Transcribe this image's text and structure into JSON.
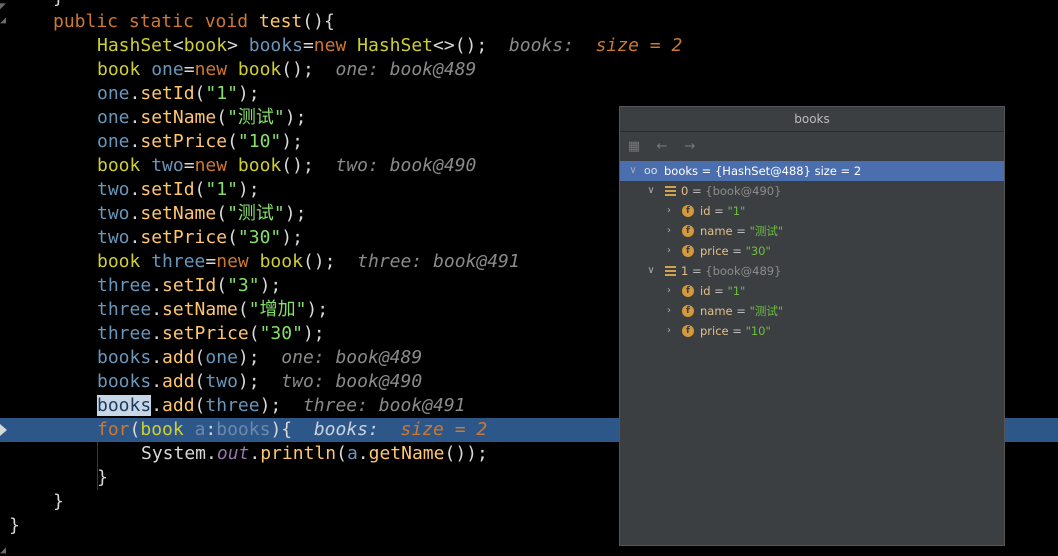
{
  "code": {
    "line0": "}",
    "line1": {
      "kw": "public static void ",
      "name": "test",
      "rest": "(){"
    },
    "line2": {
      "type": "HashSet",
      "lt": "<",
      "gen": "book",
      "gt": ">",
      "sp": " ",
      "var": "books",
      "eq": "=",
      "new": "new ",
      "ctor": "HashSet",
      "diam": "<>",
      "end": "();",
      "hint1": "books: ",
      "hint2": "size = 2"
    },
    "line3": {
      "type": "book",
      "sp": " ",
      "var": "one",
      "eq": "=",
      "new": "new ",
      "ctor": "book",
      "end": "();",
      "hint": "one: book@489"
    },
    "line4": {
      "obj": "one",
      "dot": ".",
      "meth": "setId",
      "open": "(",
      "str": "\"1\"",
      "close": ");"
    },
    "line5": {
      "obj": "one",
      "dot": ".",
      "meth": "setName",
      "open": "(",
      "str": "\"测试\"",
      "close": ");"
    },
    "line6": {
      "obj": "one",
      "dot": ".",
      "meth": "setPrice",
      "open": "(",
      "str": "\"10\"",
      "close": ");"
    },
    "line7": {
      "type": "book",
      "sp": " ",
      "var": "two",
      "eq": "=",
      "new": "new ",
      "ctor": "book",
      "end": "();",
      "hint": "two: book@490"
    },
    "line8": {
      "obj": "two",
      "dot": ".",
      "meth": "setId",
      "open": "(",
      "str": "\"1\"",
      "close": ");"
    },
    "line9": {
      "obj": "two",
      "dot": ".",
      "meth": "setName",
      "open": "(",
      "str": "\"测试\"",
      "close": ");"
    },
    "line10": {
      "obj": "two",
      "dot": ".",
      "meth": "setPrice",
      "open": "(",
      "str": "\"30\"",
      "close": ");"
    },
    "line11": {
      "type": "book",
      "sp": " ",
      "var": "three",
      "eq": "=",
      "new": "new ",
      "ctor": "book",
      "end": "();",
      "hint": "three: book@491"
    },
    "line12": {
      "obj": "three",
      "dot": ".",
      "meth": "setId",
      "open": "(",
      "str": "\"3\"",
      "close": ");"
    },
    "line13": {
      "obj": "three",
      "dot": ".",
      "meth": "setName",
      "open": "(",
      "str": "\"增加\"",
      "close": ");"
    },
    "line14": {
      "obj": "three",
      "dot": ".",
      "meth": "setPrice",
      "open": "(",
      "str": "\"30\"",
      "close": ");"
    },
    "line15": {
      "obj": "books",
      "dot": ".",
      "meth": "add",
      "open": "(",
      "arg": "one",
      "close": ");",
      "hint": "one: book@489"
    },
    "line16": {
      "obj": "books",
      "dot": ".",
      "meth": "add",
      "open": "(",
      "arg": "two",
      "close": ");",
      "hint": "two: book@490"
    },
    "line17": {
      "obj": "books",
      "dot": ".",
      "meth": "add",
      "open": "(",
      "arg": "three",
      "close": ");",
      "hint": "three: book@491"
    },
    "line18": {
      "kw": "for",
      "open": "(",
      "type": "book",
      "sp": " ",
      "var": "a",
      "colon": ":",
      "coll": "books",
      "close": "){",
      "hint1": "books: ",
      "hint2": "size = 2"
    },
    "line19": {
      "cls": "System",
      "dot1": ".",
      "field": "out",
      "dot2": ".",
      "meth": "println",
      "open": "(",
      "arg": "a",
      "dot3": ".",
      "getter": "getName",
      "close": "());"
    },
    "line20": "}",
    "line21": "}",
    "line22": "}"
  },
  "popup": {
    "title": "books",
    "toolbar": {
      "icon1": "variables-icon",
      "icon2": "back-arrow-icon",
      "icon3": "forward-arrow-icon"
    },
    "tree": [
      {
        "name": "books",
        "value": "{HashSet@488}  size = 2"
      },
      {
        "name": "0",
        "value": "{book@490}"
      },
      {
        "name": "id",
        "value": "\"1\""
      },
      {
        "name": "name",
        "value": "\"测试\""
      },
      {
        "name": "price",
        "value": "\"30\""
      },
      {
        "name": "1",
        "value": "{book@489}"
      },
      {
        "name": "id",
        "value": "\"1\""
      },
      {
        "name": "name",
        "value": "\"测试\""
      },
      {
        "name": "price",
        "value": "\"10\""
      }
    ],
    "eq": " = ",
    "oo": "oo",
    "f": "f"
  }
}
